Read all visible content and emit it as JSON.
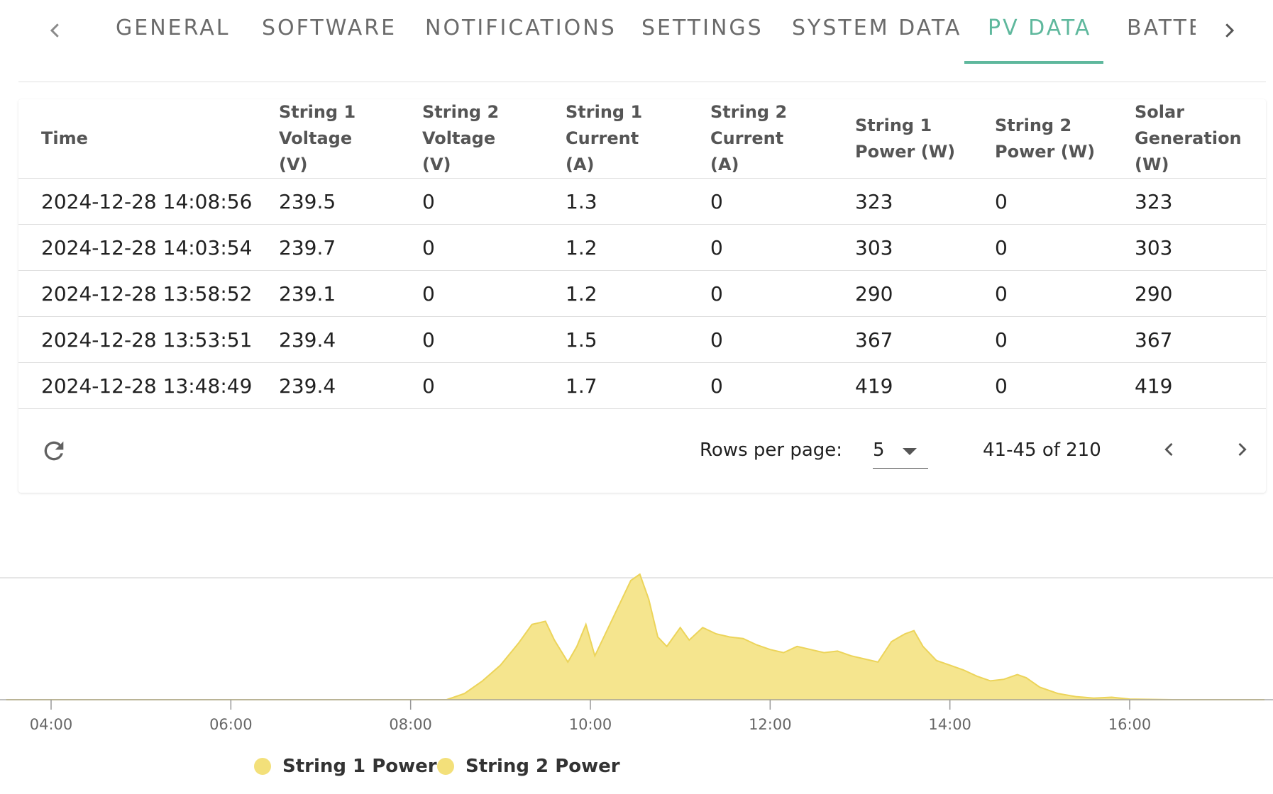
{
  "tabs": {
    "items": [
      {
        "label": "GENERAL"
      },
      {
        "label": "SOFTWARE"
      },
      {
        "label": "NOTIFICATIONS"
      },
      {
        "label": "SETTINGS"
      },
      {
        "label": "SYSTEM DATA"
      },
      {
        "label": "PV DATA"
      },
      {
        "label": "BATTE"
      }
    ],
    "active": "PV DATA",
    "accent_color": "#5fb89d"
  },
  "table": {
    "headers": [
      "Time",
      "String 1 Voltage (V)",
      "String 2 Voltage (V)",
      "String 1 Current (A)",
      "String 2 Current (A)",
      "String 1 Power (W)",
      "String 2 Power (W)",
      "Solar Generation (W)"
    ],
    "rows": [
      [
        "2024-12-28 14:08:56",
        "239.5",
        "0",
        "1.3",
        "0",
        "323",
        "0",
        "323"
      ],
      [
        "2024-12-28 14:03:54",
        "239.7",
        "0",
        "1.2",
        "0",
        "303",
        "0",
        "303"
      ],
      [
        "2024-12-28 13:58:52",
        "239.1",
        "0",
        "1.2",
        "0",
        "290",
        "0",
        "290"
      ],
      [
        "2024-12-28 13:53:51",
        "239.4",
        "0",
        "1.5",
        "0",
        "367",
        "0",
        "367"
      ],
      [
        "2024-12-28 13:48:49",
        "239.4",
        "0",
        "1.7",
        "0",
        "419",
        "0",
        "419"
      ]
    ]
  },
  "pagination": {
    "rows_per_page_label": "Rows per page:",
    "rows_per_page": "5",
    "range": "41-45 of 210"
  },
  "chart_data": {
    "type": "area",
    "x_ticks": [
      "04:00",
      "06:00",
      "08:00",
      "10:00",
      "12:00",
      "14:00",
      "16:00"
    ],
    "x_range_hours": [
      3.5,
      17.5
    ],
    "series": [
      {
        "name": "String 1 Power",
        "color": "#f3e07a",
        "points": [
          [
            3.5,
            0
          ],
          [
            5.0,
            0
          ],
          [
            6.5,
            0
          ],
          [
            8.0,
            0
          ],
          [
            8.4,
            0
          ],
          [
            8.6,
            20
          ],
          [
            8.8,
            60
          ],
          [
            9.0,
            110
          ],
          [
            9.2,
            180
          ],
          [
            9.35,
            240
          ],
          [
            9.5,
            250
          ],
          [
            9.6,
            190
          ],
          [
            9.75,
            120
          ],
          [
            9.85,
            170
          ],
          [
            9.95,
            240
          ],
          [
            10.05,
            140
          ],
          [
            10.15,
            200
          ],
          [
            10.3,
            290
          ],
          [
            10.45,
            380
          ],
          [
            10.55,
            400
          ],
          [
            10.65,
            320
          ],
          [
            10.75,
            200
          ],
          [
            10.85,
            170
          ],
          [
            11.0,
            230
          ],
          [
            11.1,
            190
          ],
          [
            11.25,
            230
          ],
          [
            11.4,
            210
          ],
          [
            11.55,
            200
          ],
          [
            11.7,
            195
          ],
          [
            11.85,
            175
          ],
          [
            12.0,
            160
          ],
          [
            12.15,
            150
          ],
          [
            12.3,
            170
          ],
          [
            12.45,
            160
          ],
          [
            12.6,
            150
          ],
          [
            12.75,
            155
          ],
          [
            12.9,
            140
          ],
          [
            13.05,
            130
          ],
          [
            13.2,
            120
          ],
          [
            13.35,
            185
          ],
          [
            13.5,
            210
          ],
          [
            13.6,
            220
          ],
          [
            13.7,
            170
          ],
          [
            13.85,
            125
          ],
          [
            14.0,
            110
          ],
          [
            14.15,
            95
          ],
          [
            14.3,
            75
          ],
          [
            14.45,
            60
          ],
          [
            14.6,
            65
          ],
          [
            14.75,
            80
          ],
          [
            14.85,
            70
          ],
          [
            15.0,
            40
          ],
          [
            15.2,
            20
          ],
          [
            15.4,
            10
          ],
          [
            15.6,
            5
          ],
          [
            15.8,
            8
          ],
          [
            16.0,
            2
          ],
          [
            16.5,
            0
          ],
          [
            17.5,
            0
          ]
        ]
      },
      {
        "name": "String 2 Power",
        "color": "#f3e07a",
        "points": []
      }
    ],
    "y_range": [
      0,
      400
    ],
    "grid": true,
    "legend": "bottom-left"
  }
}
